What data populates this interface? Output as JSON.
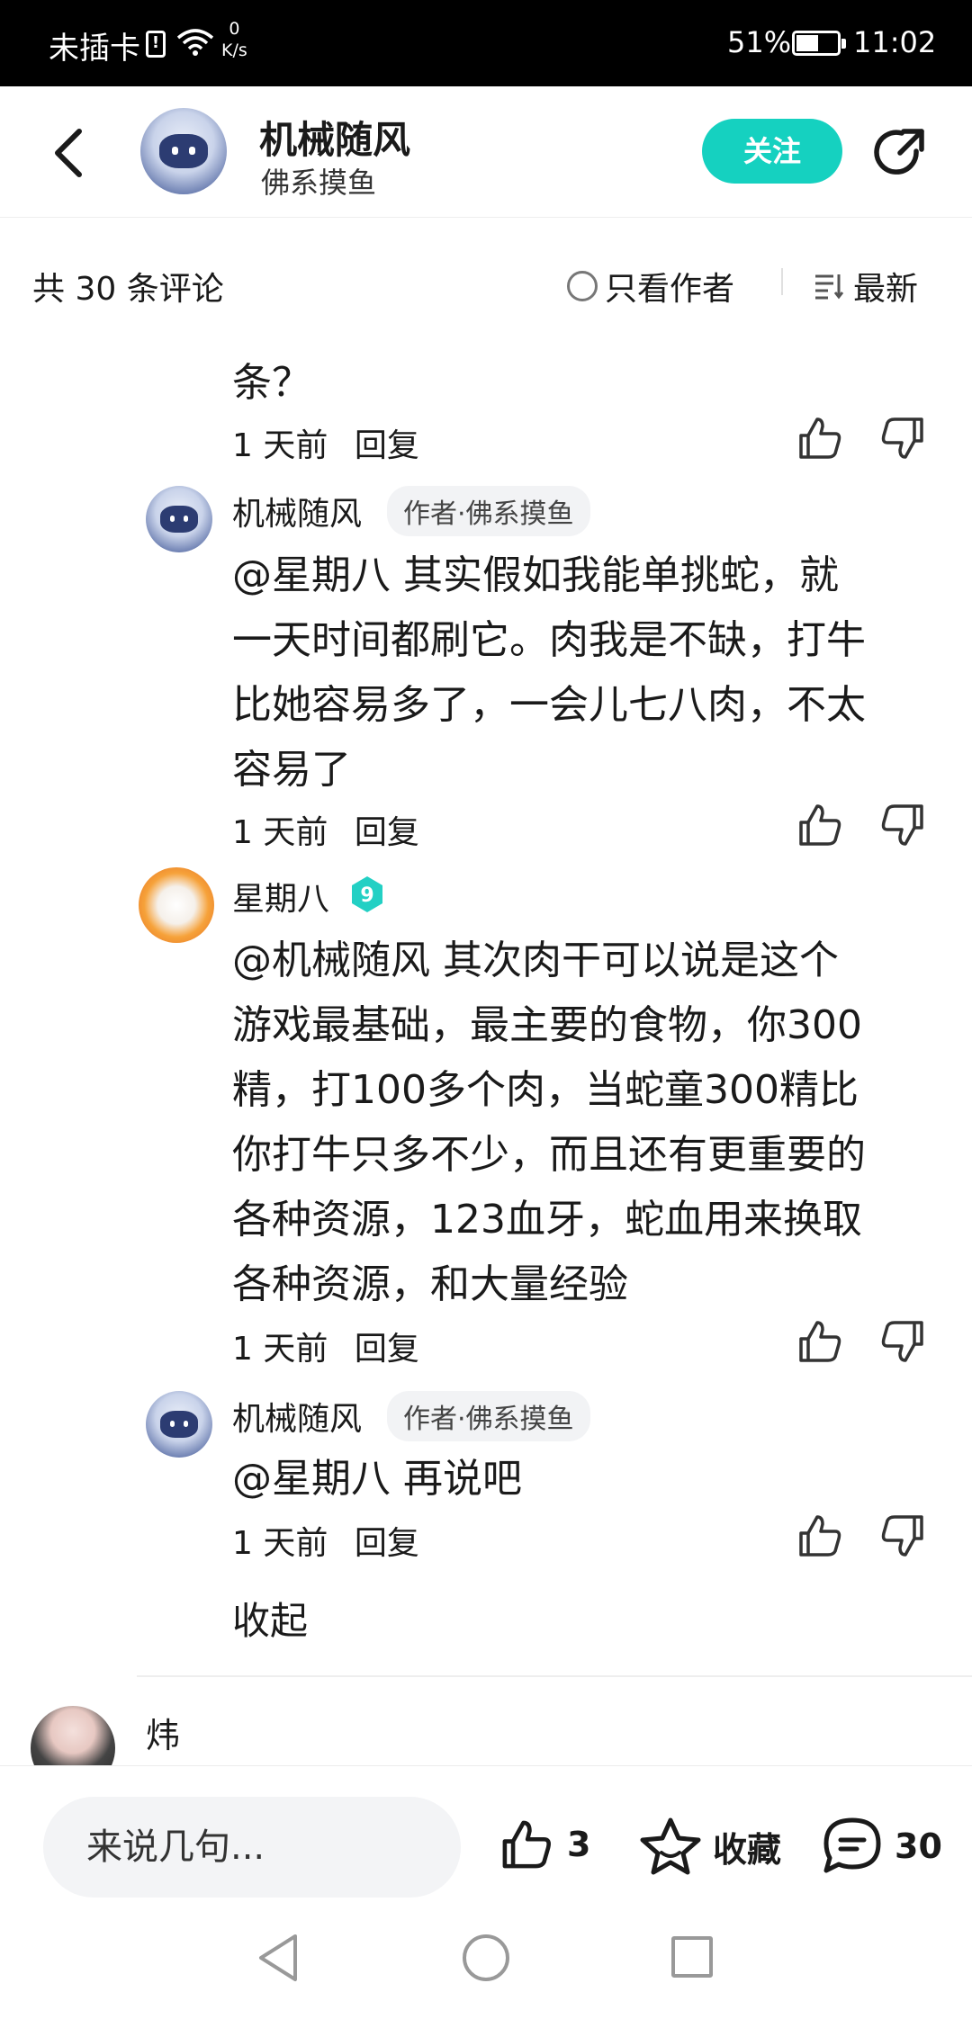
{
  "status_bar": {
    "carrier": "未插卡",
    "sim_icon": "!",
    "net_speed_value": "0",
    "net_speed_unit": "K/s",
    "battery": "51%",
    "time": "11:02"
  },
  "header": {
    "name": "机械随风",
    "subtitle": "佛系摸鱼",
    "follow_label": "关注"
  },
  "toolbar": {
    "count_label": "共 30 条评论",
    "author_only_label": "只看作者",
    "sort_label": "最新"
  },
  "comments": [
    {
      "lines": [
        "条？"
      ],
      "time": "1 天前",
      "reply_label": "回复"
    },
    {
      "author": "机械随风",
      "tag": "作者·佛系摸鱼",
      "lines": [
        "@星期八  其实假如我能单挑蛇，就",
        "一天时间都刷它。肉我是不缺，打牛",
        "比她容易多了，一会儿七八肉，不太",
        "容易了"
      ],
      "time": "1 天前",
      "reply_label": "回复"
    },
    {
      "author": "星期八",
      "level": "9",
      "lines": [
        "@机械随风  其次肉干可以说是这个",
        "游戏最基础，最主要的食物，你300",
        "精，打100多个肉，当蛇童300精比",
        "你打牛只多不少，而且还有更重要的",
        "各种资源，123血牙，蛇血用来换取",
        "各种资源，和大量经验"
      ],
      "time": "1 天前",
      "reply_label": "回复"
    },
    {
      "author": "机械随风",
      "tag": "作者·佛系摸鱼",
      "lines": [
        "@星期八  再说吧"
      ],
      "time": "1 天前",
      "reply_label": "回复"
    }
  ],
  "collapse_label": "收起",
  "next_comment": {
    "author": "炜"
  },
  "bottom_bar": {
    "input_placeholder": "来说几句...",
    "like_count": "3",
    "favorite_label": "收藏",
    "comment_count": "30"
  },
  "colors": {
    "accent": "#15d1c0",
    "status_bar_bg": "#000000",
    "tag_bg": "#f2f3f5"
  }
}
